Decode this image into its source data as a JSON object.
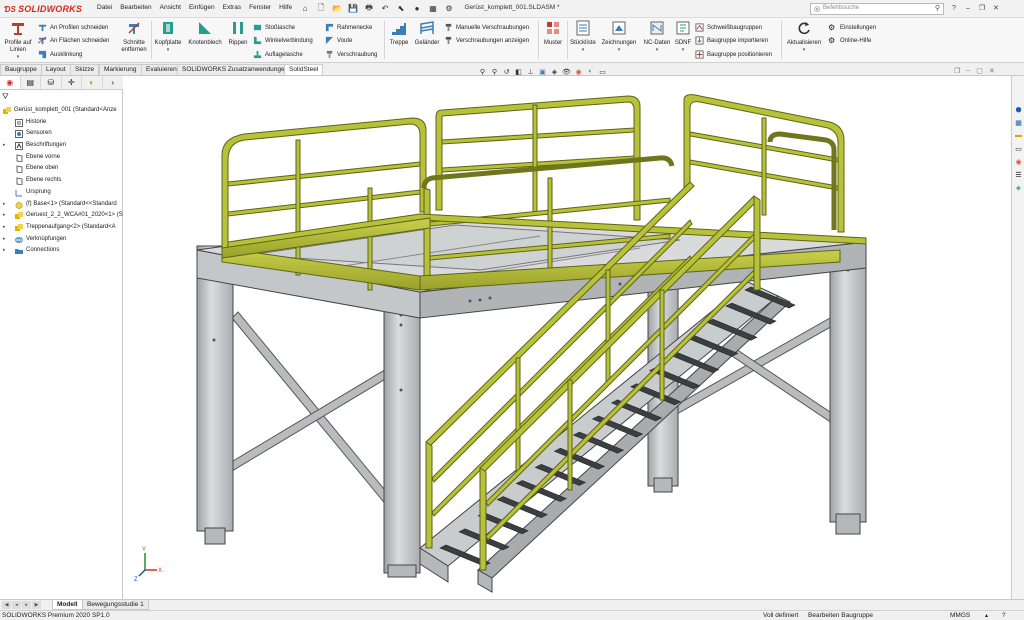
{
  "app": {
    "name": "SOLIDWORKS",
    "document_title": "Gerüst_komplett_001.SLDASM *"
  },
  "menu": [
    "Datei",
    "Bearbeiten",
    "Ansicht",
    "Einfügen",
    "Extras",
    "Fenster",
    "Hilfe"
  ],
  "search": {
    "placeholder": "Befehlssuche"
  },
  "ribbon": {
    "profile": "Profile auf Linien",
    "profile_cut": "An Profilen schneiden",
    "face_cut": "An Flächen schneiden",
    "notch": "Ausklinkung",
    "remove_cuts": "Schnitte entfernen",
    "head_plate": "Kopfplatte",
    "gusset": "Knotenblech",
    "ribs": "Rippen",
    "butt_plate": "Stoßlasche",
    "angle_conn": "Winkelverbindung",
    "support_plate": "Auflagelasche",
    "frame_corner": "Rahmenecke",
    "haunch": "Voute",
    "bolting": "Verschraubung",
    "stairs": "Treppe",
    "railing": "Geländer",
    "manual_bolting": "Manuelle Verschraubungen",
    "show_bolting": "Verschraubungen anzeigen",
    "pattern": "Muster",
    "bom": "Stückliste",
    "drawings": "Zeichnungen",
    "nc_data": "NC-Daten",
    "sdnf": "SDNF",
    "weld_groups": "Schweißbaugruppen",
    "import_assy": "Baugruppe importieren",
    "position_assy": "Baugruppe positionieren",
    "refresh": "Aktualisieren",
    "settings": "Einstellungen",
    "online_help": "Online-Hilfe"
  },
  "command_tabs": [
    "Baugruppe",
    "Layout",
    "Skizze",
    "Markierung",
    "Evaluieren",
    "SOLIDWORKS Zusatzanwendungen",
    "SolidSteel"
  ],
  "active_command_tab": "SolidSteel",
  "tree": {
    "root": "Gerüst_komplett_001  (Standard<Anze",
    "items": [
      {
        "label": "Historie",
        "icon": "history-icon"
      },
      {
        "label": "Sensoren",
        "icon": "sensor-icon"
      },
      {
        "label": "Beschriftungen",
        "icon": "annotation-icon"
      },
      {
        "label": "Ebene vorne",
        "icon": "plane-icon"
      },
      {
        "label": "Ebene oben",
        "icon": "plane-icon"
      },
      {
        "label": "Ebene rechts",
        "icon": "plane-icon"
      },
      {
        "label": "Ursprung",
        "icon": "origin-icon"
      },
      {
        "label": "(f) Base<1> (Standard<<Standard",
        "icon": "part-icon"
      },
      {
        "label": "Geruest_2_2_WCA#01_2020<1> (S",
        "icon": "assembly-icon"
      },
      {
        "label": "Treppenaufgang<2> (Standard<A",
        "icon": "assembly-icon"
      },
      {
        "label": "Verknüpfungen",
        "icon": "mates-icon"
      },
      {
        "label": "Connections",
        "icon": "folder-icon"
      }
    ]
  },
  "bottom_tabs": [
    "Modell",
    "Bewegungsstudie 1"
  ],
  "active_bottom_tab": "Modell",
  "status": {
    "version": "SOLIDWORKS Premium 2020 SP1.0",
    "defined": "Voll definiert",
    "editing": "Bearbeiten Baugruppe",
    "units": "MMGS"
  },
  "triad": {
    "x": "X",
    "y": "Y",
    "z": "Z"
  },
  "colors": {
    "steel": "#c9cccd",
    "railing": "#b8c13a",
    "accent": "#d52b1e"
  }
}
